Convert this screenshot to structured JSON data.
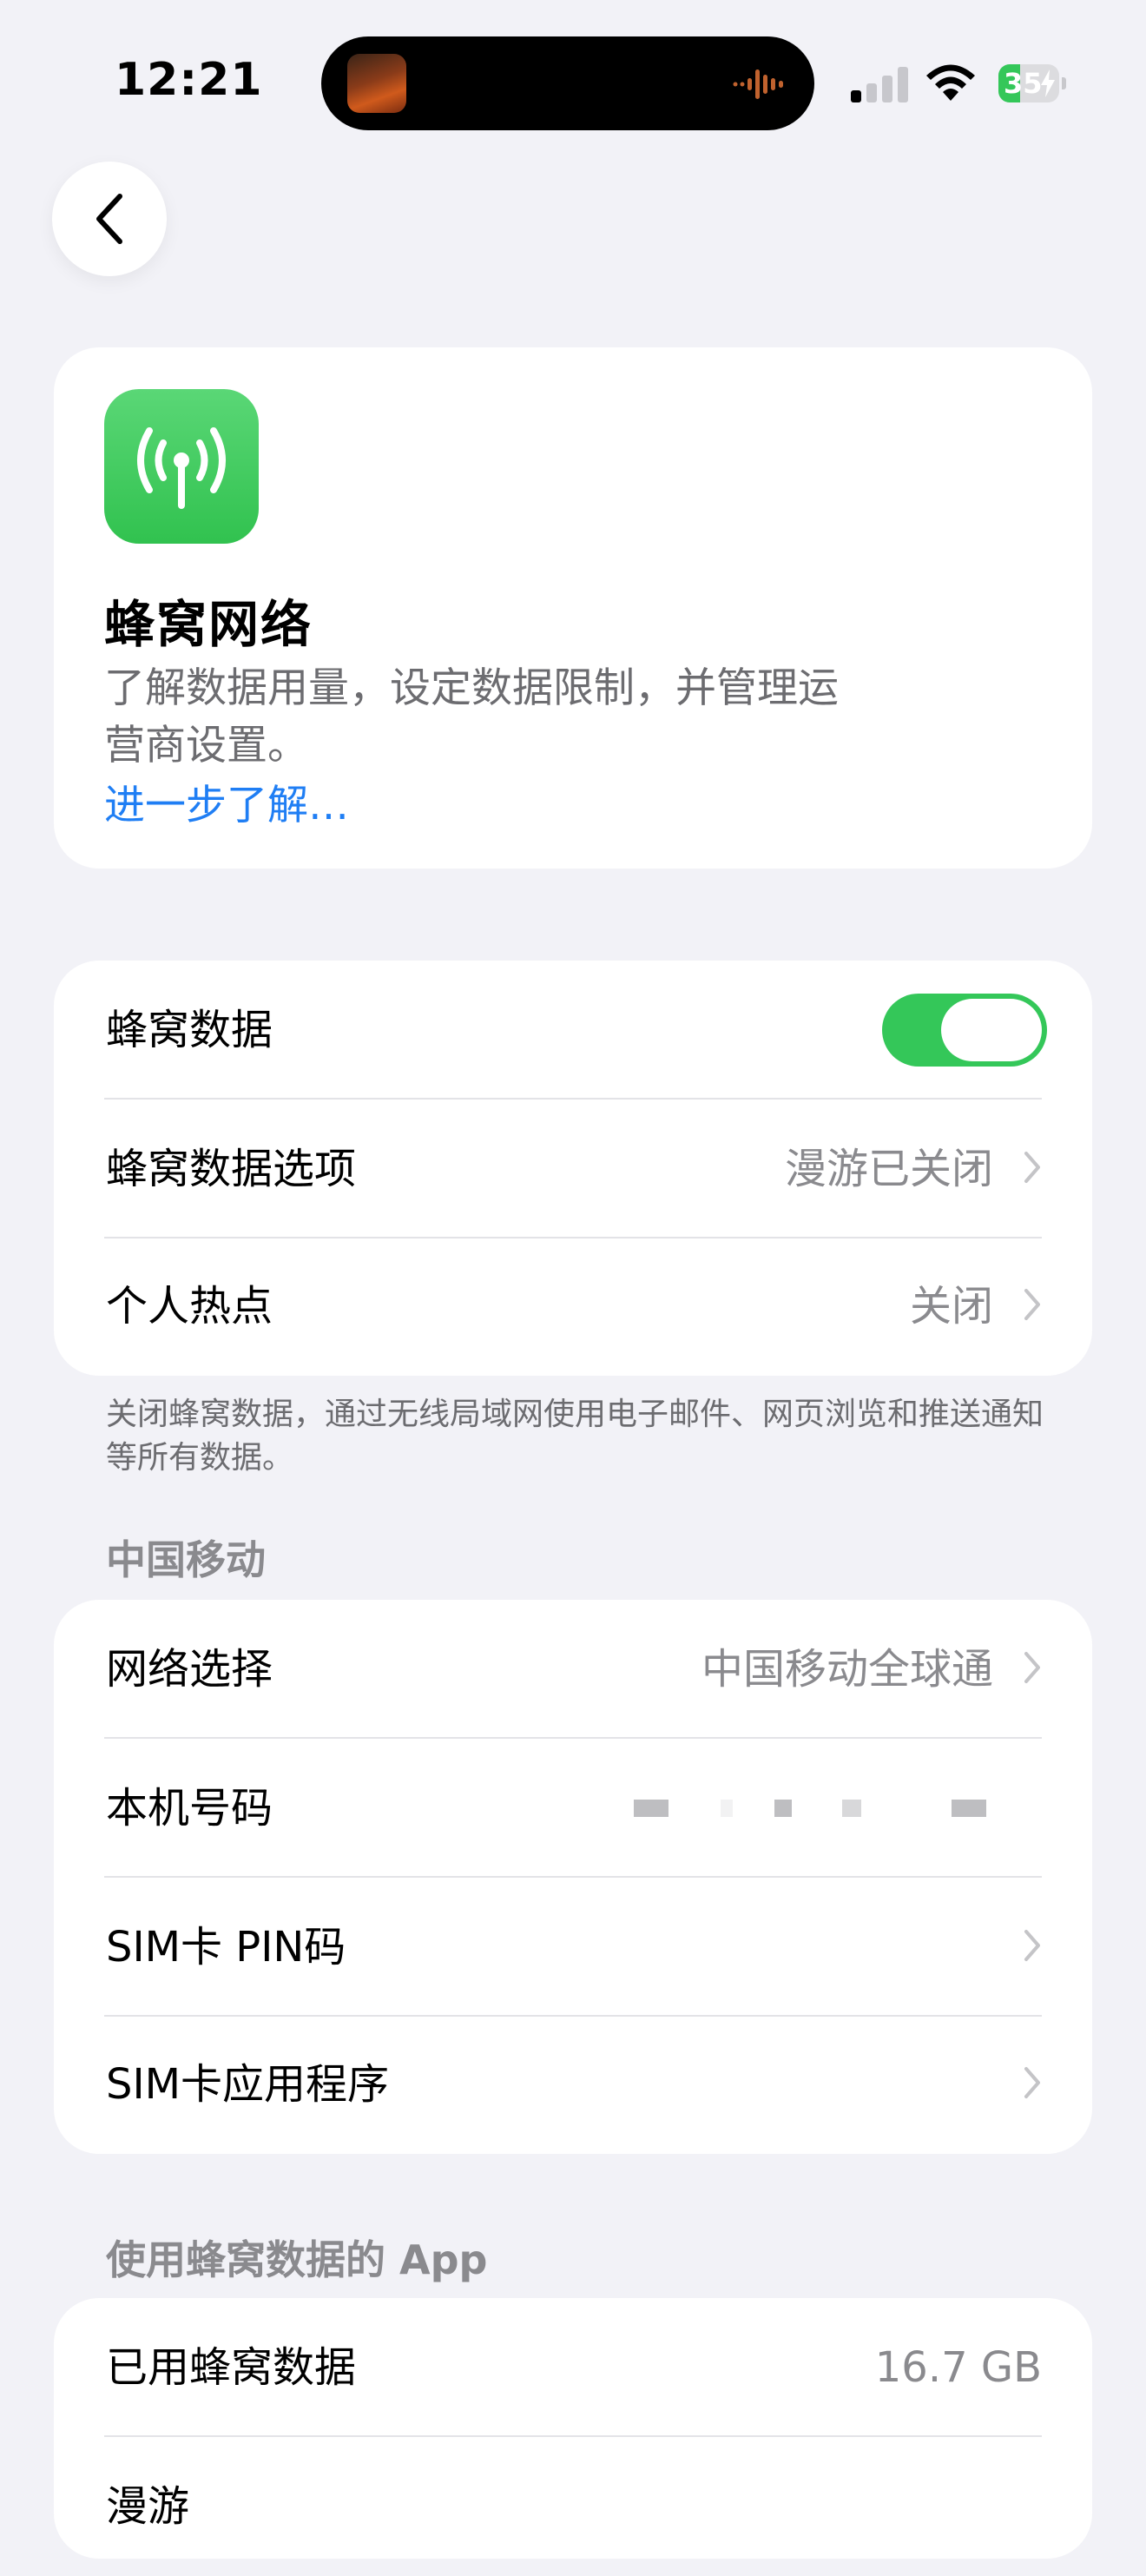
{
  "status_bar": {
    "time": "12:21",
    "battery_percent": "35",
    "battery_level": 0.35,
    "icons": [
      "signal-icon",
      "wifi-icon",
      "battery-icon",
      "waveform-icon"
    ]
  },
  "nav": {
    "back_icon": "chevron-left-icon"
  },
  "intro": {
    "icon": "antenna-icon",
    "title": "蜂窝网络",
    "description": "了解数据用量，设定数据限制，并管理运营商设置。",
    "link": "进一步了解…"
  },
  "group1": {
    "cellular_data": {
      "label": "蜂窝数据",
      "toggle_on": true
    },
    "data_options": {
      "label": "蜂窝数据选项",
      "value": "漫游已关闭"
    },
    "hotspot": {
      "label": "个人热点",
      "value": "关闭"
    }
  },
  "footnote": "关闭蜂窝数据，通过无线局域网使用电子邮件、网页浏览和推送通知等所有数据。",
  "carrier_section": {
    "header": "中国移动",
    "network_selection": {
      "label": "网络选择",
      "value": "中国移动全球通"
    },
    "my_number": {
      "label": "本机号码"
    },
    "sim_pin": {
      "label": "SIM卡 PIN码"
    },
    "sim_apps": {
      "label": "SIM卡应用程序"
    }
  },
  "apps_section": {
    "header": "使用蜂窝数据的 App",
    "used_data": {
      "label": "已用蜂窝数据",
      "value": "16.7 GB"
    },
    "partial_next_label": "漫游"
  },
  "colors": {
    "background": "#f2f2f7",
    "accent_green": "#34c759",
    "link_blue": "#1f7ef4",
    "secondary_text": "#8a8a8e"
  }
}
